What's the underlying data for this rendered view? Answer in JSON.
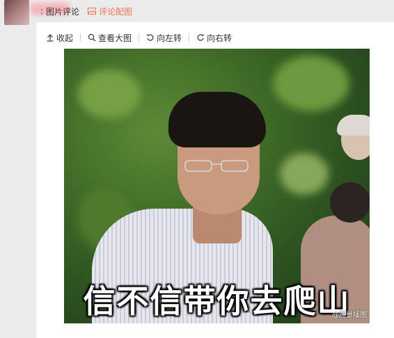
{
  "header": {
    "colon": ":",
    "picture_comment": "图片评论",
    "comment_image_label": "评论配图"
  },
  "toolbar": {
    "collapse": "收起",
    "view_large": "查看大图",
    "rotate_left": "向左转",
    "rotate_right": "向右转"
  },
  "image": {
    "caption": "信不信带你去爬山",
    "watermark": "@图景插图"
  },
  "colors": {
    "accent": "#eb7350",
    "panel_bg": "#ffffff",
    "page_bg": "#ebebeb"
  }
}
